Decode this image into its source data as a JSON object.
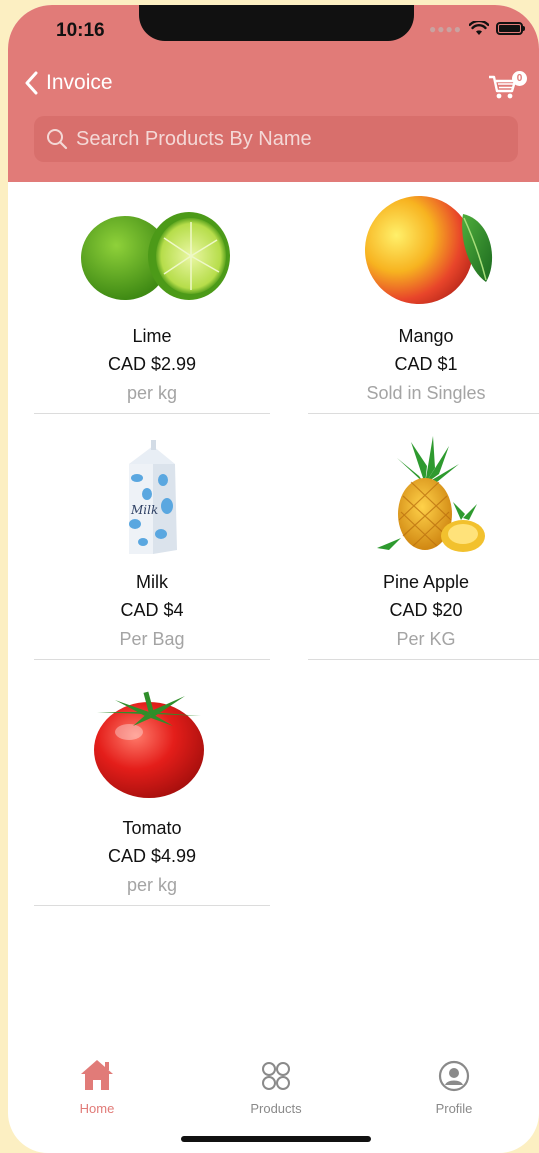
{
  "status": {
    "time": "10:16"
  },
  "header": {
    "back_label": "Invoice",
    "cart_count": "0",
    "search_placeholder": "Search Products By Name"
  },
  "colors": {
    "accent": "#e17b78",
    "muted": "#a4a4a4"
  },
  "products": [
    {
      "name": "Lime",
      "price": "CAD $2.99",
      "unit": "per kg",
      "icon": "lime-image"
    },
    {
      "name": "Mango",
      "price": "CAD $1",
      "unit": "Sold in Singles",
      "icon": "mango-image"
    },
    {
      "name": "Milk",
      "price": "CAD $4",
      "unit": "Per Bag",
      "icon": "milk-carton-image"
    },
    {
      "name": "Pine Apple",
      "price": "CAD $20",
      "unit": "Per KG",
      "icon": "pineapple-image"
    },
    {
      "name": "Tomato",
      "price": "CAD $4.99",
      "unit": "per kg",
      "icon": "tomato-image"
    }
  ],
  "tabs": [
    {
      "label": "Home",
      "icon": "home-icon",
      "active": true
    },
    {
      "label": "Products",
      "icon": "grid-icon",
      "active": false
    },
    {
      "label": "Profile",
      "icon": "profile-icon",
      "active": false
    }
  ]
}
